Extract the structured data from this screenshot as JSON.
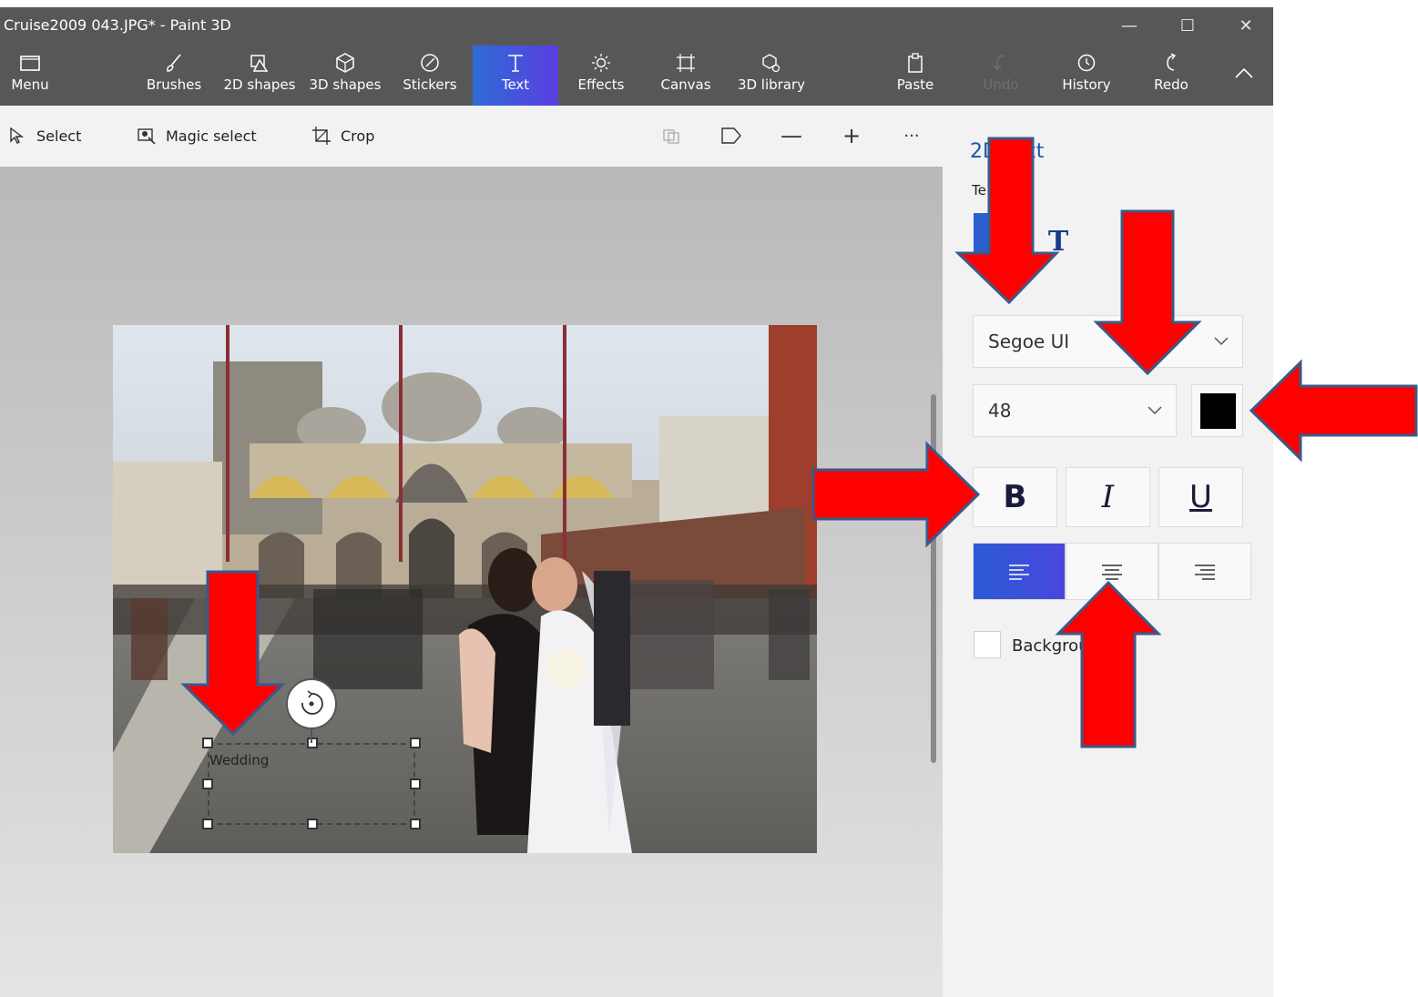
{
  "window": {
    "title": "Cruise2009 043.JPG* - Paint 3D",
    "minimize": "—",
    "maximize": "☐",
    "close": "✕"
  },
  "ribbon": {
    "menu": "Menu",
    "brushes": "Brushes",
    "shapes2d": "2D shapes",
    "shapes3d": "3D shapes",
    "stickers": "Stickers",
    "text": "Text",
    "effects": "Effects",
    "canvas": "Canvas",
    "library3d": "3D library",
    "paste": "Paste",
    "undo": "Undo",
    "history": "History",
    "redo": "Redo",
    "collapse": "^"
  },
  "toolbar": {
    "select": "Select",
    "magic_select": "Magic select",
    "crop": "Crop",
    "zoom_out": "—",
    "zoom_in": "+",
    "more": "···"
  },
  "canvas": {
    "textbox_content": "Wedding"
  },
  "panel": {
    "title": "2D text",
    "text_type_label": "Te",
    "font": "Segoe UI",
    "size": "48",
    "bold": "B",
    "italic": "I",
    "underline": "U",
    "background_label": "Background fill",
    "text_color": "#000000",
    "accent": "#2b5fd0"
  }
}
